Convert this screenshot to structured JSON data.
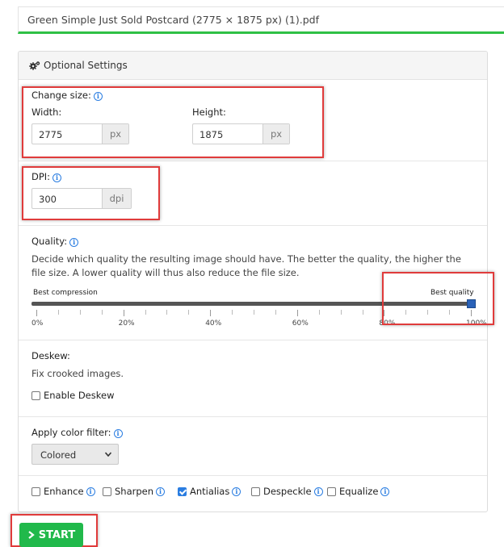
{
  "file": {
    "name": "Green Simple Just Sold Postcard (2775 × 1875 px) (1).pdf"
  },
  "panel": {
    "title": "Optional Settings"
  },
  "size": {
    "label": "Change size:",
    "width_label": "Width:",
    "width_value": "2775",
    "width_unit": "px",
    "height_label": "Height:",
    "height_value": "1875",
    "height_unit": "px"
  },
  "dpi": {
    "label": "DPI:",
    "value": "300",
    "unit": "dpi"
  },
  "quality": {
    "label": "Quality:",
    "description": "Decide which quality the resulting image should have. The better the quality, the higher the file size. A lower quality will thus also reduce the file size.",
    "min_label": "Best compression",
    "max_label": "Best quality",
    "ticks": [
      "0%",
      "20%",
      "40%",
      "60%",
      "80%",
      "100%"
    ],
    "value_percent": 100
  },
  "deskew": {
    "label": "Deskew:",
    "description": "Fix crooked images.",
    "checkbox_label": "Enable Deskew",
    "checked": false
  },
  "color_filter": {
    "label": "Apply color filter:",
    "selected": "Colored"
  },
  "options": [
    {
      "label": "Enhance",
      "checked": false
    },
    {
      "label": "Sharpen",
      "checked": false
    },
    {
      "label": "Antialias",
      "checked": true
    },
    {
      "label": "Despeckle",
      "checked": false
    },
    {
      "label": "Equalize",
      "checked": false
    }
  ],
  "start_button": {
    "label": "START"
  },
  "colors": {
    "accent_green": "#21b94b",
    "info_blue": "#2a7de1",
    "highlight_red": "#e03b3b"
  }
}
